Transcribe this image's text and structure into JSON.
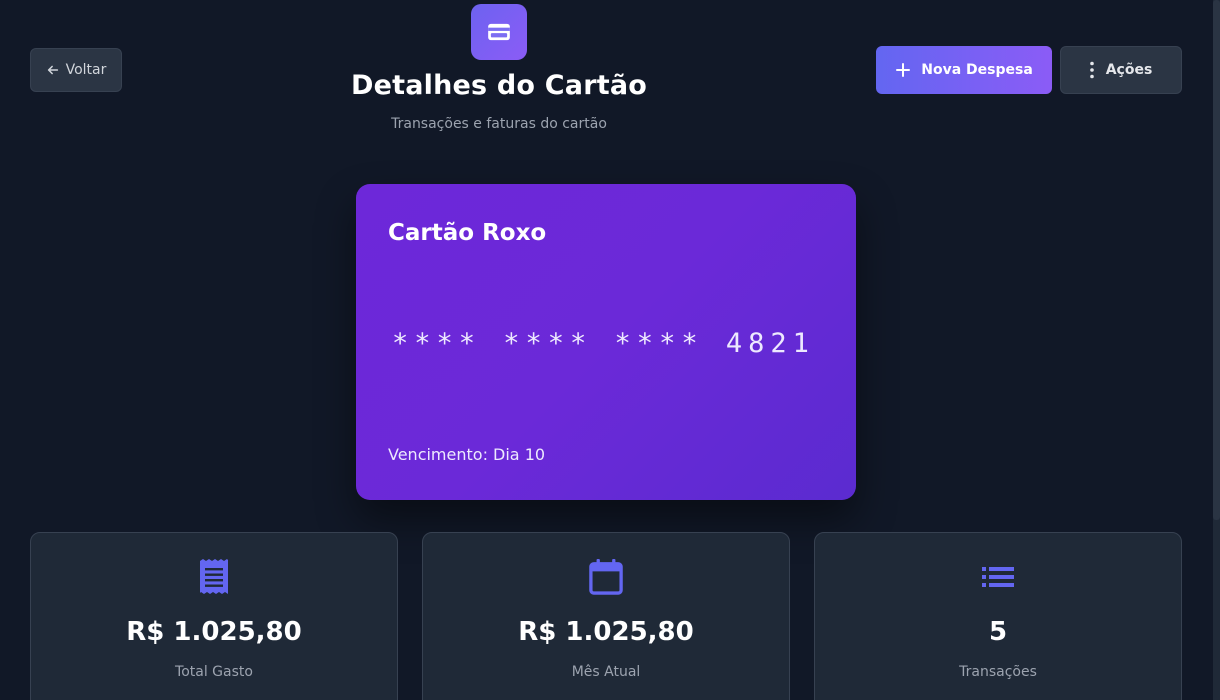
{
  "header": {
    "back_label": "Voltar",
    "title": "Detalhes do Cartão",
    "subtitle": "Transações e faturas do cartão",
    "new_expense_label": "Nova Despesa",
    "actions_label": "Ações"
  },
  "card": {
    "name": "Cartão Roxo",
    "number": "**** **** **** 4821",
    "due": "Vencimento: Dia 10",
    "color": "#6d28d9"
  },
  "stats": [
    {
      "icon": "receipt-icon",
      "value": "R$ 1.025,80",
      "label": "Total Gasto"
    },
    {
      "icon": "calendar-icon",
      "value": "R$ 1.025,80",
      "label": "Mês Atual"
    },
    {
      "icon": "list-icon",
      "value": "5",
      "label": "Transações"
    }
  ],
  "colors": {
    "background": "#111827",
    "accent": "#6366f1",
    "accent_end": "#8b5cf6",
    "panel": "#1f2937"
  }
}
